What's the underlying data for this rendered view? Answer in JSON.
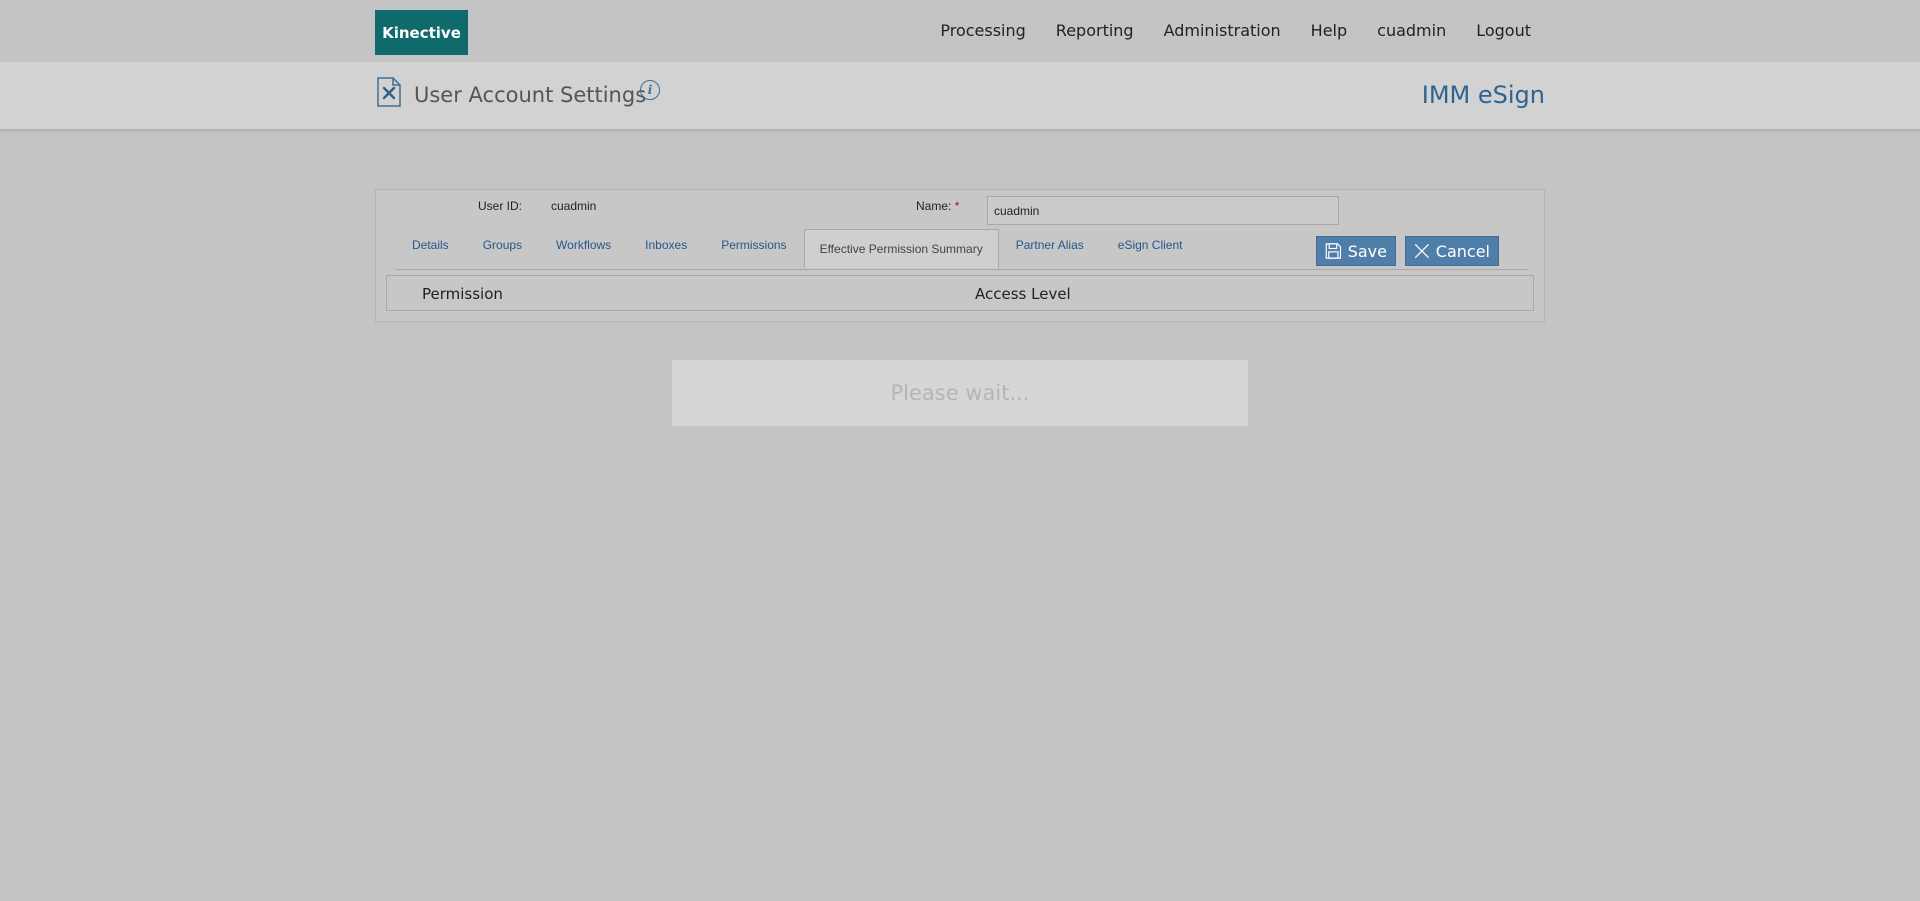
{
  "brand": {
    "logo_text": "Kinective"
  },
  "nav": {
    "items": [
      "Processing",
      "Reporting",
      "Administration",
      "Help",
      "cuadmin",
      "Logout"
    ]
  },
  "header": {
    "icon": "settings-document-icon",
    "title": "User Account Settings",
    "info_glyph": "i",
    "product": "IMM eSign"
  },
  "form": {
    "user_id_label": "User ID:",
    "user_id_value": "cuadmin",
    "name_label": "Name:",
    "required_marker": "*",
    "name_value": "cuadmin"
  },
  "tabs": [
    {
      "label": "Details",
      "active": false
    },
    {
      "label": "Groups",
      "active": false
    },
    {
      "label": "Workflows",
      "active": false
    },
    {
      "label": "Inboxes",
      "active": false
    },
    {
      "label": "Permissions",
      "active": false
    },
    {
      "label": "Effective Permission Summary",
      "active": true
    },
    {
      "label": "Partner Alias",
      "active": false
    },
    {
      "label": "eSign Client",
      "active": false
    }
  ],
  "actions": {
    "save_label": "Save",
    "cancel_label": "Cancel"
  },
  "grid": {
    "columns": [
      "Permission",
      "Access Level"
    ]
  },
  "loading": {
    "message": "Please wait..."
  },
  "colors": {
    "logo_bg": "#0f6b6b",
    "link": "#24588a",
    "product": "#2f6393",
    "button": "#4f7fa9",
    "required": "#d0021b"
  }
}
